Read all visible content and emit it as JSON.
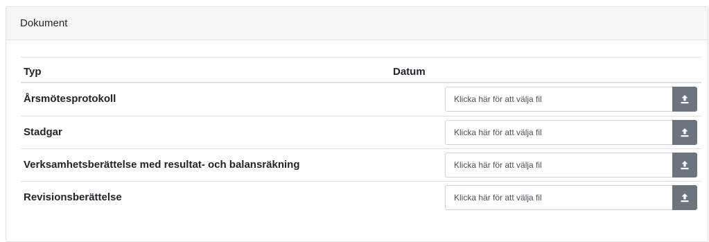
{
  "panel": {
    "title": "Dokument"
  },
  "table": {
    "headers": {
      "typ": "Typ",
      "datum": "Datum"
    },
    "rows": [
      {
        "typ": "Årsmötesprotokoll",
        "placeholder": "Klicka här för att välja fil"
      },
      {
        "typ": "Stadgar",
        "placeholder": "Klicka här för att välja fil"
      },
      {
        "typ": "Verksamhetsberättelse med resultat- och balansräkning",
        "placeholder": "Klicka här för att välja fil"
      },
      {
        "typ": "Revisionsberättelse",
        "placeholder": "Klicka här för att välja fil"
      }
    ]
  },
  "icons": {
    "upload": "upload-icon"
  },
  "colors": {
    "upload_button": "#6c757d",
    "header_bg": "#f7f7f7",
    "border": "#dee2e6"
  }
}
